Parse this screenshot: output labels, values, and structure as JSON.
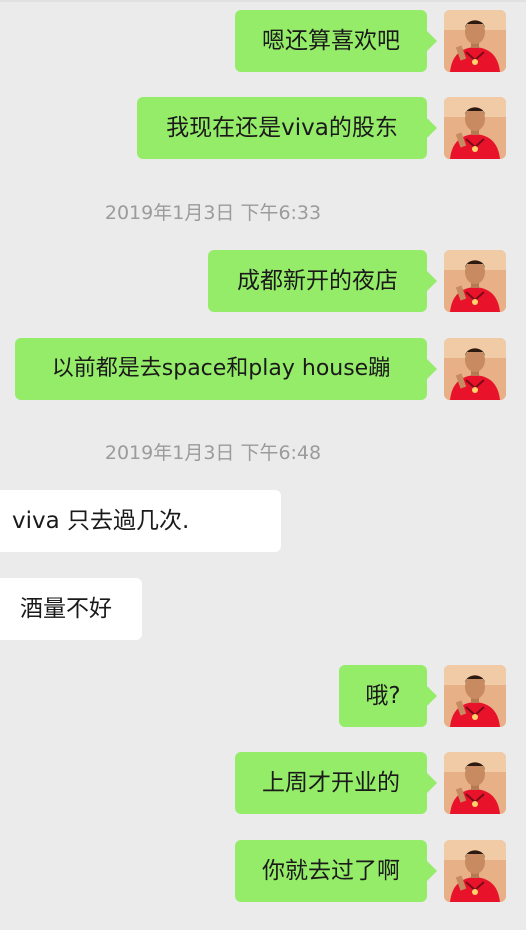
{
  "messages": [
    {
      "direction": "sent",
      "text": "嗯还算喜欢吧"
    },
    {
      "direction": "sent",
      "text": "我现在还是viva的股东"
    },
    {
      "type": "timestamp",
      "text": "2019年1月3日 下午6:33"
    },
    {
      "direction": "sent",
      "text": "成都新开的夜店"
    },
    {
      "direction": "sent",
      "text": "以前都是去space和play house蹦"
    },
    {
      "type": "timestamp",
      "text": "2019年1月3日 下午6:48"
    },
    {
      "direction": "received",
      "text": "viva 只去過几次."
    },
    {
      "direction": "received",
      "text": "酒量不好"
    },
    {
      "direction": "sent",
      "text": "哦?"
    },
    {
      "direction": "sent",
      "text": "上周才开业的"
    },
    {
      "direction": "sent",
      "text": "你就去过了啊"
    }
  ],
  "colors": {
    "background": "#ebebeb",
    "sent_bubble": "#95ec69",
    "received_bubble": "#ffffff",
    "timestamp_text": "#9b9b9b",
    "avatar_shirt": "#e8132a"
  },
  "icons": {
    "avatar": "user-avatar-red-shirt"
  }
}
